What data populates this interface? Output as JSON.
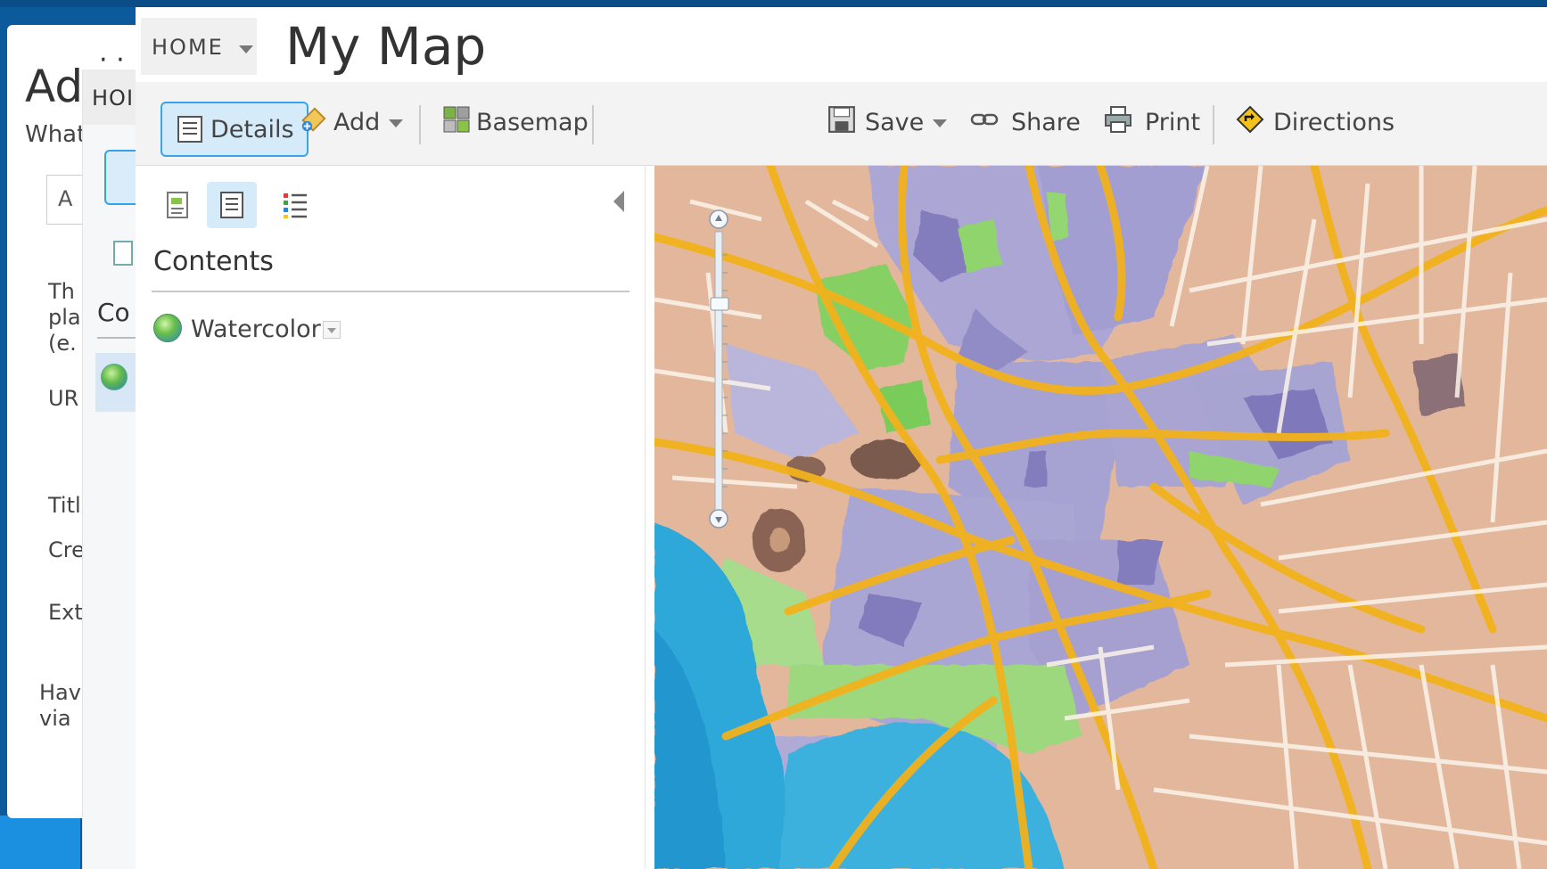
{
  "background_dialog": {
    "title_fragment": "Ad",
    "question_fragment": "What",
    "input_fragment": "A",
    "desc_lines": [
      "Th",
      "pla",
      "(e."
    ],
    "url_fragment": "UR",
    "title_field": "Titl",
    "credits_field": "Cre",
    "extent_field": "Ext",
    "help_lines": [
      "Hav",
      "via"
    ]
  },
  "background_window": {
    "home_fragment": "HOI",
    "contents_fragment": "Co"
  },
  "header": {
    "home_label": "HOME",
    "map_title": "My Map"
  },
  "toolbar": {
    "details": "Details",
    "add": "Add",
    "basemap": "Basemap",
    "save": "Save",
    "share": "Share",
    "print": "Print",
    "directions": "Directions"
  },
  "panel": {
    "heading": "Contents",
    "layers": [
      {
        "name": "Watercolor"
      }
    ]
  },
  "colors": {
    "accent_blue": "#3aa4eb",
    "selected_bg": "#d6ebfa",
    "map_road": "#f2b21c",
    "map_water": "#2aa6d8",
    "map_park": "#8bd46a",
    "map_block": "#e0a888",
    "map_purple": "#a7a6d8"
  },
  "map": {
    "basemap": "Watercolor"
  }
}
